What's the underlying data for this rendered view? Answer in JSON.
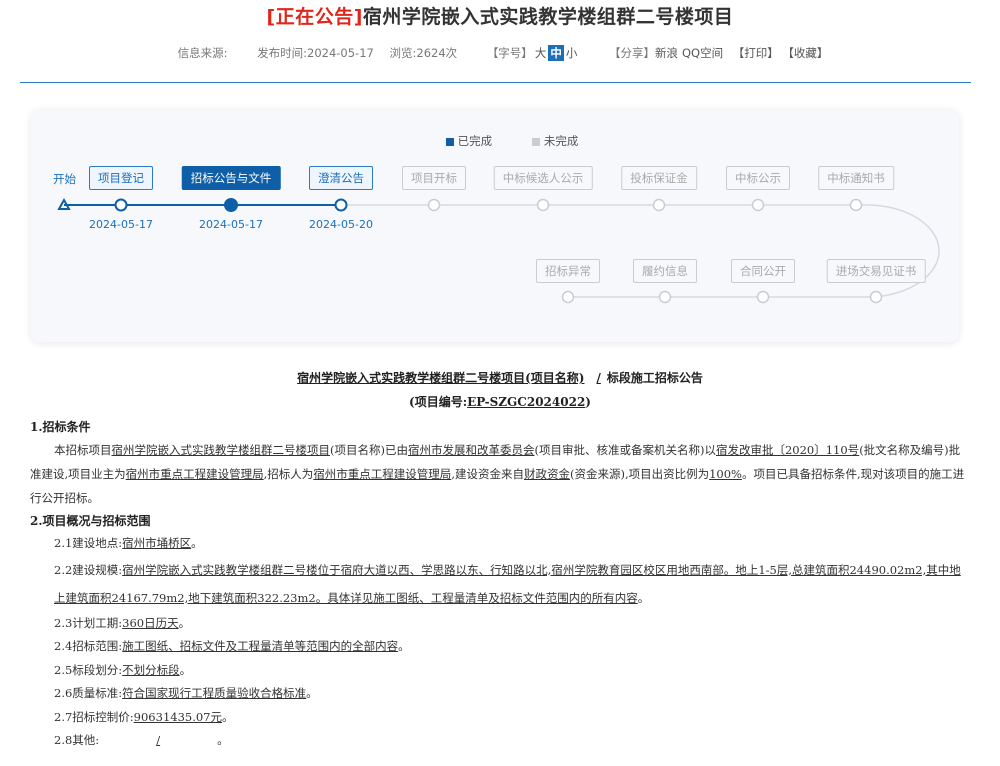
{
  "header": {
    "tag": "[正在公告]",
    "title": "宿州学院嵌入式实践教学楼组群二号楼项目",
    "source_label": "信息来源:",
    "publish_label": "发布时间:",
    "publish_date": "2024-05-17",
    "views_label": "浏览:",
    "views": "2624次",
    "fontsize_label": "【字号】",
    "font_large": "大",
    "font_medium": "中",
    "font_small": "小",
    "share_label": "【分享】",
    "share_sina": "新浪",
    "share_qzone": "QQ空间",
    "print": "【打印】",
    "favorite": "【收藏】"
  },
  "progress": {
    "legend_done": "已完成",
    "legend_todo": "未完成",
    "start": "开始",
    "colors": {
      "done": "#0f5fa8",
      "todo": "#c9ccd1"
    },
    "stages": [
      {
        "label": "项目登记",
        "date": "2024-05-17",
        "status": "done"
      },
      {
        "label": "招标公告与文件",
        "date": "2024-05-17",
        "status": "current"
      },
      {
        "label": "澄清公告",
        "date": "2024-05-20",
        "status": "done"
      },
      {
        "label": "项目开标",
        "status": "todo"
      },
      {
        "label": "中标候选人公示",
        "status": "todo"
      },
      {
        "label": "投标保证金",
        "status": "todo"
      },
      {
        "label": "中标公示",
        "status": "todo"
      },
      {
        "label": "中标通知书",
        "status": "todo"
      },
      {
        "label": "招标异常",
        "status": "todo"
      },
      {
        "label": "履约信息",
        "status": "todo"
      },
      {
        "label": "合同公开",
        "status": "todo"
      },
      {
        "label": "进场交易见证书",
        "status": "todo"
      }
    ]
  },
  "notice": {
    "title_main": "宿州学院嵌入式实践教学楼组群二号楼项目(项目名称)",
    "title_slash": "/",
    "title_end": "标段施工招标公告",
    "code_label": "(项目编号:",
    "code": "EP-SZGC2024022",
    "code_end": ")",
    "s1_title": "1.招标条件",
    "s1_p1a": "本招标项目",
    "s1_p1b": "宿州学院嵌入式实践教学楼组群二号楼项目",
    "s1_p1c": "(项目名称)已由",
    "s1_p1d": "宿州市发展和改革委员会",
    "s1_p1e": "(项目审批、核准或备案机关名称)以",
    "s1_p1f": "宿发改审批〔2020〕110号",
    "s1_p1g": "(批文名称及编号)批准建设,项目业主为",
    "s1_p1h": "宿州市重点工程建设管理局",
    "s1_p1i": ",招标人为",
    "s1_p1j": "宿州市重点工程建设管理局",
    "s1_p1k": ",建设资金来自",
    "s1_p1l": "财政资金",
    "s1_p1m": "(资金来源),项目出资比例为",
    "s1_p1n": "100%",
    "s1_p1o": "。项目已具备招标条件,现对该项目的施工进行公开招标。",
    "s2_title": "2.项目概况与招标范围",
    "i21_label": "2.1建设地点:",
    "i21_value": "宿州市埇桥区",
    "i22_label": "2.2建设规模:",
    "i22_value": "宿州学院嵌入式实践教学楼组群二号楼位于宿府大道以西、学思路以东、行知路以北,宿州学院教育园区校区用地西南部。地上1-5层,总建筑面积24490.02m2,其中地上建筑面积24167.79m2,地下建筑面积322.23m2。具体详见施工图纸、工程量清单及招标文件范围内的所有内容",
    "i23_label": "2.3计划工期:",
    "i23_value": "360日历天",
    "i24_label": "2.4招标范围:",
    "i24_value": "施工图纸、招标文件及工程量清单等范围内的全部内容",
    "i25_label": "2.5标段划分:",
    "i25_value": "不划分标段",
    "i26_label": "2.6质量标准:",
    "i26_value": "符合国家现行工程质量验收合格标准",
    "i27_label": "2.7招标控制价:",
    "i27_value": "90631435.07元",
    "i28_label": "2.8其他:",
    "i28_value": "/",
    "period": "。"
  }
}
